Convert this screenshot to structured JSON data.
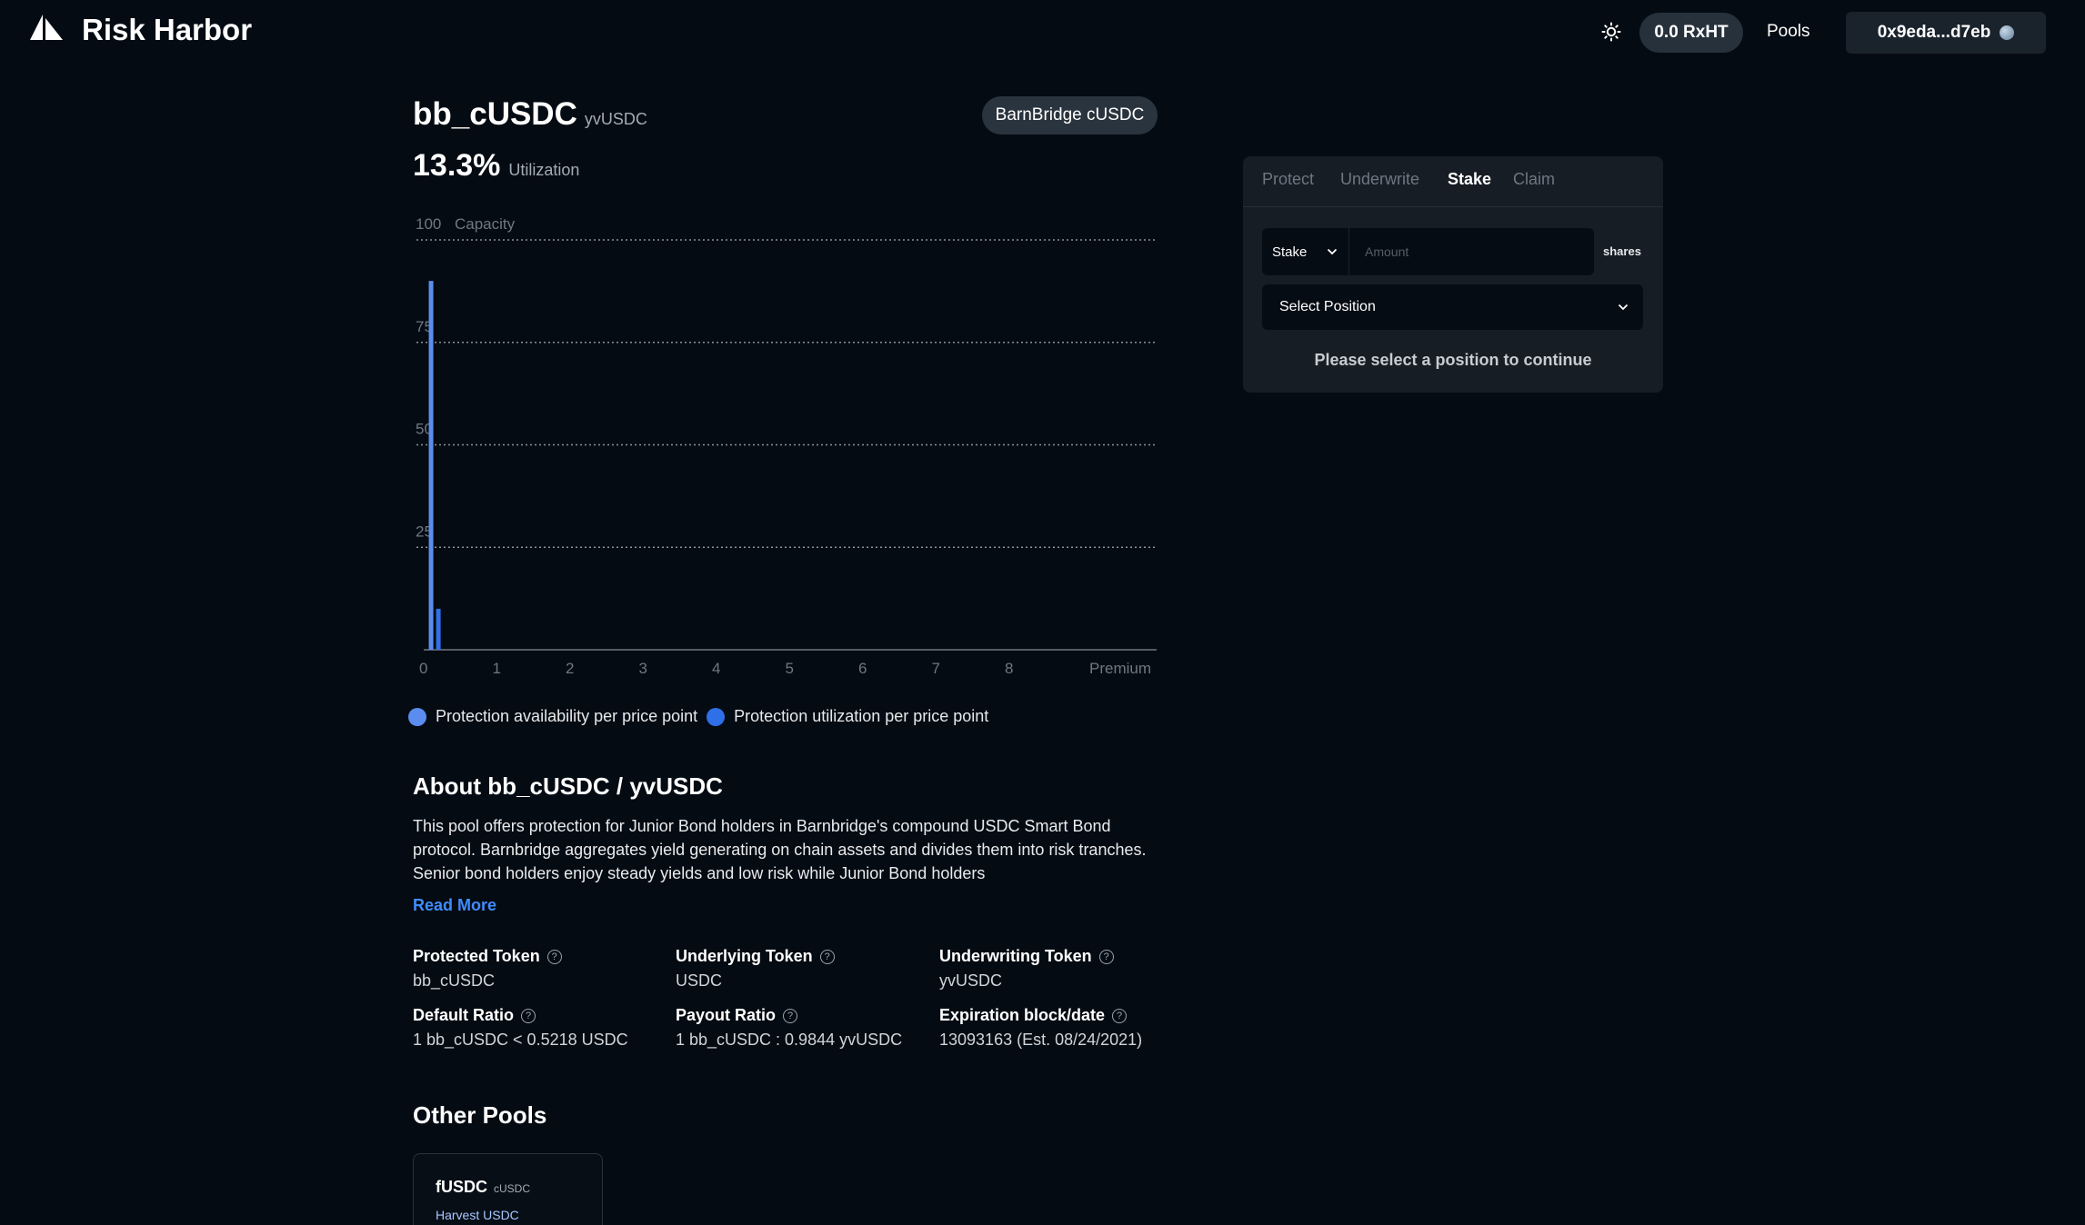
{
  "header": {
    "brand": "Risk Harbor",
    "token_balance": "0.0 RxHT",
    "pools_link": "Pools",
    "wallet": "0x9eda...d7eb"
  },
  "pool": {
    "name": "bb_cUSDC",
    "underwriting_symbol": "yvUSDC",
    "badge": "BarnBridge cUSDC",
    "utilization_value": "13.3%",
    "utilization_label": "Utilization"
  },
  "chart_data": {
    "type": "bar",
    "ylabel": "Capacity",
    "xlabel": "Premium",
    "ylim": [
      0,
      100
    ],
    "xlim": [
      0,
      10
    ],
    "x_ticks": [
      "0",
      "1",
      "2",
      "3",
      "4",
      "5",
      "6",
      "7",
      "8"
    ],
    "y_ticks": [
      "100",
      "75",
      "50",
      "25"
    ],
    "grid": "horizontal dotted",
    "series": [
      {
        "name": "Protection availability per price point",
        "color": "#5b8def",
        "x": [
          0.1
        ],
        "values": [
          90
        ]
      },
      {
        "name": "Protection utilization per price point",
        "color": "#2f6fe8",
        "x": [
          0.2
        ],
        "values": [
          10
        ]
      }
    ]
  },
  "legend": {
    "availability": "Protection availability per price point",
    "utilization": "Protection utilization per price point",
    "availability_color": "#5b8def",
    "utilization_color": "#2f6fe8"
  },
  "about": {
    "title": "About bb_cUSDC / yvUSDC",
    "text": "This pool offers protection for Junior Bond holders in Barnbridge's compound USDC Smart Bond protocol. Barnbridge aggregates yield generating on chain assets and divides them into risk tranches. Senior bond holders enjoy steady yields and low risk while Junior Bond holders",
    "read_more": "Read More"
  },
  "info": {
    "protected_token_label": "Protected Token",
    "protected_token": "bb_cUSDC",
    "underlying_token_label": "Underlying Token",
    "underlying_token": "USDC",
    "underwriting_token_label": "Underwriting Token",
    "underwriting_token": "yvUSDC",
    "default_ratio_label": "Default Ratio",
    "default_ratio": "1 bb_cUSDC < 0.5218 USDC",
    "payout_ratio_label": "Payout Ratio",
    "payout_ratio": "1 bb_cUSDC : 0.9844 yvUSDC",
    "expiration_label": "Expiration block/date",
    "expiration": "13093163 (Est. 08/24/2021)"
  },
  "other_pools": {
    "title": "Other Pools",
    "items": [
      {
        "name": "fUSDC",
        "symbol": "cUSDC",
        "protocol": "Harvest USDC"
      }
    ]
  },
  "panel": {
    "tabs": [
      "Protect",
      "Underwrite",
      "Stake",
      "Claim"
    ],
    "active_tab": "Stake",
    "action_select": "Stake",
    "amount_placeholder": "Amount",
    "unit": "shares",
    "position_select": "Select Position",
    "message": "Please select a position to continue"
  }
}
